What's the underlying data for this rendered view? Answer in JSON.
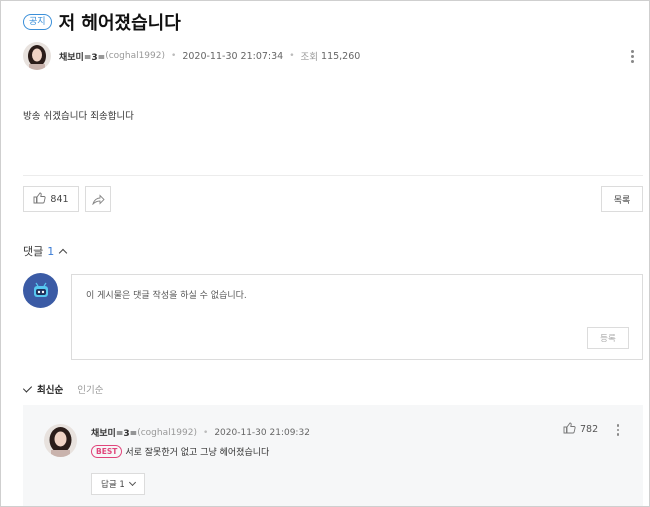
{
  "post": {
    "notice_badge": "공지",
    "title": "저 헤어졌습니다",
    "author_name": "채보미=3=",
    "author_id": "(coghal1992)",
    "date": "2020-11-30 21:07:34",
    "views_label": "조회",
    "views": "115,260",
    "body": "방송 쉬겠습니다 죄송합니다"
  },
  "actions": {
    "like_count": "841",
    "list_label": "목록"
  },
  "comments": {
    "label": "댓글",
    "count": "1",
    "input_placeholder": "이 게시물은 댓글 작성을 하실 수 없습니다.",
    "submit_label": "등록",
    "sort_latest": "최신순",
    "sort_popular": "인기순",
    "items": [
      {
        "author_name": "채보미=3=",
        "author_id": "(coghal1992)",
        "date": "2020-11-30 21:09:32",
        "badge": "BEST",
        "text": "서로 잘못한거 없고 그냥 헤어졌습니다",
        "likes": "782",
        "reply_label": "답글 1"
      }
    ]
  },
  "colors": {
    "accent_blue": "#3a7bd5",
    "best_pink": "#e0457b",
    "comment_bg": "#f6f7f8"
  },
  "icons": [
    "more-vertical-icon",
    "thumbs-up-icon",
    "share-icon",
    "chevron-up-icon",
    "check-icon",
    "chevron-down-icon"
  ]
}
